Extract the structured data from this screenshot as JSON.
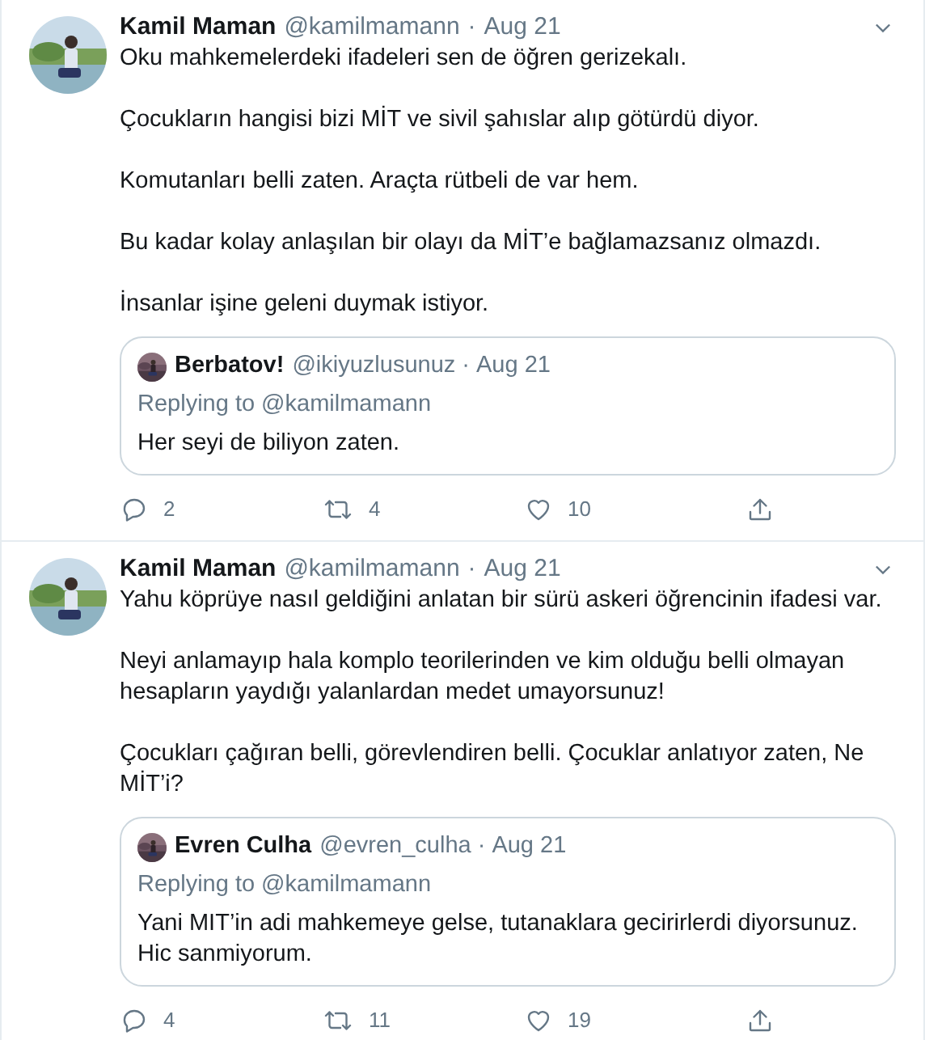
{
  "tweets": [
    {
      "name": "Kamil Maman",
      "handle": "@kamilmamann",
      "separator": "·",
      "date": "Aug 21",
      "paragraphs": [
        "Oku mahkemelerdeki ifadeleri sen de öğren gerizekalı.",
        "Çocukların hangisi bizi MİT ve sivil şahıslar alıp götürdü diyor.",
        "Komutanları belli zaten. Araçta rütbeli de var hem.",
        "Bu kadar kolay anlaşılan bir olayı da MİT’e bağlamazsanız olmazdı.",
        "İnsanlar işine geleni duymak istiyor."
      ],
      "quote": {
        "name": "Berbatov!",
        "handle": "@ikiyuzlusunuz",
        "separator": "·",
        "date": "Aug 21",
        "replying_label": "Replying to",
        "replying_to": "@kamilmamann",
        "text": "Her seyi de biliyon zaten."
      },
      "replies": "2",
      "retweets": "4",
      "likes": "10"
    },
    {
      "name": "Kamil Maman",
      "handle": "@kamilmamann",
      "separator": "·",
      "date": "Aug 21",
      "paragraphs": [
        "Yahu köprüye nasıl geldiğini anlatan bir sürü askeri öğrencinin ifadesi var.",
        "Neyi anlamayıp hala komplo teorilerinden ve kim olduğu belli olmayan hesapların yaydığı yalanlardan medet umayorsunuz!",
        "Çocukları çağıran belli, görevlendiren belli. Çocuklar anlatıyor zaten, Ne MİT’i?"
      ],
      "quote": {
        "name": "Evren Culha",
        "handle": "@evren_culha",
        "separator": "·",
        "date": "Aug 21",
        "replying_label": "Replying to",
        "replying_to": "@kamilmamann",
        "text": "Yani MIT’in adi mahkemeye gelse, tutanaklara gecirirlerdi diyorsunuz. Hic sanmiyorum."
      },
      "replies": "4",
      "retweets": "11",
      "likes": "19"
    }
  ]
}
